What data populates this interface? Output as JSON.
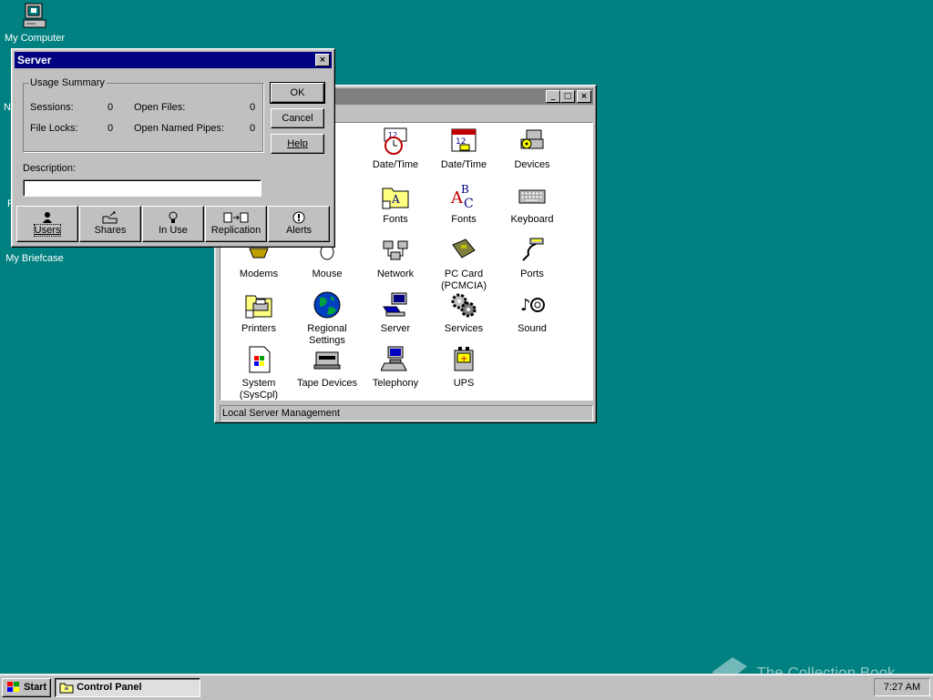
{
  "desktop": {
    "icons": [
      {
        "label": "My Computer"
      },
      {
        "label": "My Briefcase"
      }
    ]
  },
  "control_panel": {
    "title": "Control Panel",
    "status": "Local Server Management",
    "items": [
      {
        "label": "Date/Time"
      },
      {
        "label": "Date/Time"
      },
      {
        "label": "Devices"
      },
      {
        "label": "Fonts"
      },
      {
        "label": "Fonts"
      },
      {
        "label": "Keyboard"
      },
      {
        "label": "Modems"
      },
      {
        "label": "Mouse"
      },
      {
        "label": "Network"
      },
      {
        "label": "PC Card (PCMCIA)"
      },
      {
        "label": "Ports"
      },
      {
        "label": "Printers"
      },
      {
        "label": "Regional Settings"
      },
      {
        "label": "Server"
      },
      {
        "label": "Services"
      },
      {
        "label": "Sound"
      },
      {
        "label": "System (SysCpl)"
      },
      {
        "label": "Tape Devices"
      },
      {
        "label": "Telephony"
      },
      {
        "label": "UPS"
      }
    ]
  },
  "server_dialog": {
    "title": "Server",
    "group_label": "Usage Summary",
    "sessions_label": "Sessions:",
    "sessions_value": "0",
    "open_files_label": "Open Files:",
    "open_files_value": "0",
    "file_locks_label": "File Locks:",
    "file_locks_value": "0",
    "named_pipes_label": "Open Named Pipes:",
    "named_pipes_value": "0",
    "description_label": "Description:",
    "description_value": "",
    "ok_label": "OK",
    "cancel_label": "Cancel",
    "help_label": "Help",
    "buttons": [
      {
        "label": "Users",
        "icon": "users-icon"
      },
      {
        "label": "Shares",
        "icon": "shares-icon"
      },
      {
        "label": "In Use",
        "icon": "in-use-icon"
      },
      {
        "label": "Replication",
        "icon": "replication-icon"
      },
      {
        "label": "Alerts",
        "icon": "alerts-icon"
      }
    ]
  },
  "taskbar": {
    "start_label": "Start",
    "task_label": "Control Panel",
    "clock": "7:27 AM"
  },
  "watermark": "The Collection Book",
  "colors": {
    "desktop": "#008080",
    "active_title": "#000080",
    "inactive_title": "#808080",
    "face": "#c0c0c0"
  }
}
